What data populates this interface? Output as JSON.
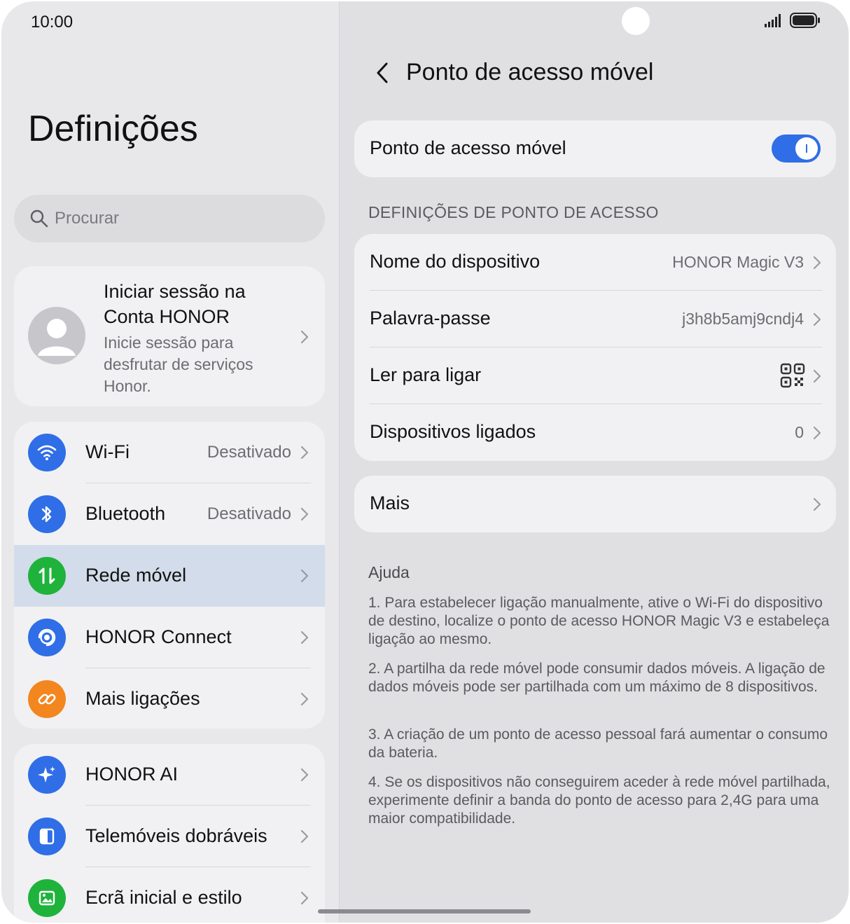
{
  "status": {
    "time": "10:00"
  },
  "left": {
    "title": "Definições",
    "search_placeholder": "Procurar",
    "account": {
      "title": "Iniciar sessão na Conta HONOR",
      "subtitle": "Inicie sessão para desfrutar de serviços Honor."
    },
    "group1": [
      {
        "label": "Wi-Fi",
        "value": "Desativado",
        "icon": "wifi-icon",
        "color": "#2f6ee6"
      },
      {
        "label": "Bluetooth",
        "value": "Desativado",
        "icon": "bluetooth-icon",
        "color": "#2f6ee6"
      },
      {
        "label": "Rede móvel",
        "value": "",
        "icon": "mobile-network-icon",
        "color": "#1fb33c"
      },
      {
        "label": "HONOR Connect",
        "value": "",
        "icon": "honor-connect-icon",
        "color": "#2f6ee6"
      },
      {
        "label": "Mais ligações",
        "value": "",
        "icon": "link-icon",
        "color": "#f3861e"
      }
    ],
    "group2": [
      {
        "label": "HONOR AI",
        "icon": "ai-sparkle-icon",
        "color": "#2f6ee6"
      },
      {
        "label": "Telemóveis dobráveis",
        "icon": "foldable-phone-icon",
        "color": "#2f6ee6"
      },
      {
        "label": "Ecrã inicial e estilo",
        "icon": "image-icon",
        "color": "#1fb33c"
      }
    ]
  },
  "right": {
    "title": "Ponto de acesso móvel",
    "hotspot_toggle_label": "Ponto de acesso móvel",
    "hotspot_enabled": true,
    "section_title": "DEFINIÇÕES DE PONTO DE ACESSO",
    "settings": [
      {
        "label": "Nome do dispositivo",
        "value": "HONOR Magic V3"
      },
      {
        "label": "Palavra-passe",
        "value": "j3h8b5amj9cndj4"
      },
      {
        "label": "Ler para ligar",
        "value": ""
      },
      {
        "label": "Dispositivos ligados",
        "value": "0"
      }
    ],
    "more_label": "Mais",
    "help_title": "Ajuda",
    "help": [
      "1. Para estabelecer ligação manualmente, ative o Wi-Fi do dispositivo de destino, localize o ponto de acesso HONOR Magic V3 e estabeleça ligação ao mesmo.",
      "2. A partilha da rede móvel pode consumir dados móveis. A ligação de dados móveis pode ser partilhada com um máximo de 8 dispositivos.",
      "3. A criação de um ponto de acesso pessoal fará aumentar o consumo da bateria.",
      "4. Se os dispositivos não conseguirem aceder à rede móvel partilhada, experimente definir a banda do ponto de acesso para 2,4G para uma maior compatibilidade."
    ]
  }
}
